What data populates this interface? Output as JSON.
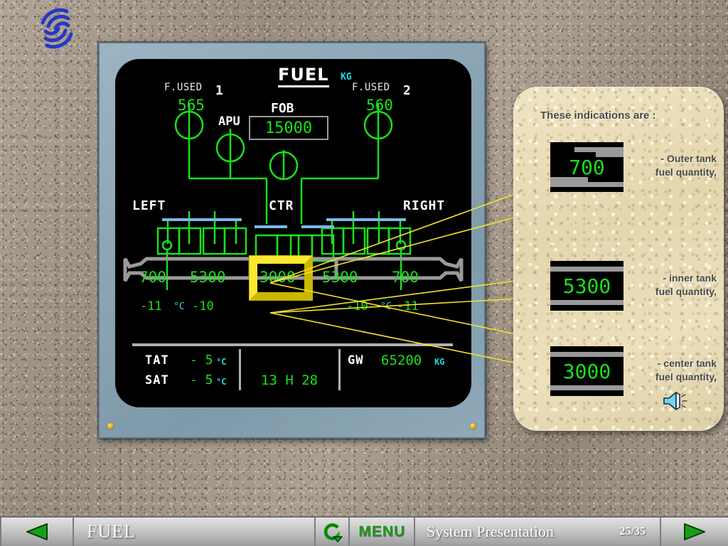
{
  "logo": {
    "name": "training-logo-swirl",
    "color": "#2638c4"
  },
  "ecam": {
    "title": "FUEL",
    "unit": "KG",
    "fuel_used": {
      "label_left": "F.USED",
      "engine_left_number": "1",
      "engine_left_value": "565",
      "label_right": "F.USED",
      "engine_right_number": "2",
      "engine_right_value": "560"
    },
    "fob": {
      "label": "FOB",
      "value": "15000"
    },
    "apu_label": "APU",
    "tank_labels": {
      "left": "LEFT",
      "center": "CTR",
      "right": "RIGHT"
    },
    "tank_quantities": {
      "left_outer": "700",
      "left_inner": "5300",
      "center": "3000",
      "right_inner": "5300",
      "right_outer": "700"
    },
    "temperatures": {
      "left_outer": "-11",
      "left_unit": "°C",
      "left_inner": "-10",
      "right_inner": "-10",
      "right_unit": "°C",
      "right_outer": "-11"
    },
    "info": {
      "tat_label": "TAT",
      "tat_value": "- 5",
      "tat_unit": "°C",
      "sat_label": "SAT",
      "sat_value": "- 5",
      "sat_unit": "°C",
      "time_value": "13 H 28",
      "gw_label": "GW",
      "gw_value": "65200",
      "gw_unit": "KG"
    },
    "highlight": {
      "target": "center-tank-quantity",
      "color": "#fbe830"
    }
  },
  "callout": {
    "title": "These indications are :",
    "items": [
      {
        "display_value": "700",
        "caption": "- Outer tank\nfuel quantity,"
      },
      {
        "display_value": "5300",
        "caption": "- inner tank\nfuel quantity,"
      },
      {
        "display_value": "3000",
        "caption": "- center tank\nfuel quantity,"
      }
    ],
    "audio_icon": "speaker-icon"
  },
  "toolbar": {
    "prev_icon": "previous-arrow-icon",
    "page_title": "FUEL",
    "back_icon": "return-arrow-icon",
    "menu_label": "MENU",
    "section_label": "System  Presentation",
    "page_indicator": "25/35",
    "next_icon": "next-arrow-icon"
  }
}
